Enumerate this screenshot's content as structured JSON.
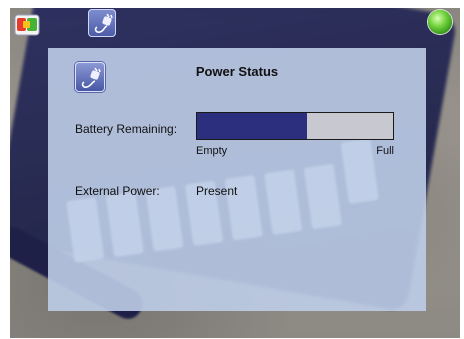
{
  "top_bar": {
    "start_icon": "start-menu-icon",
    "power_icon": "power-plug-icon",
    "status_led": "green-status-light"
  },
  "dialog": {
    "title": "Power Status",
    "icon": "power-plug-icon",
    "battery": {
      "label": "Battery Remaining:",
      "level_fraction": 0.56,
      "min_label": "Empty",
      "max_label": "Full",
      "fill_color": "#2b2f7e"
    },
    "external_power": {
      "label": "External Power:",
      "value": "Present"
    }
  }
}
